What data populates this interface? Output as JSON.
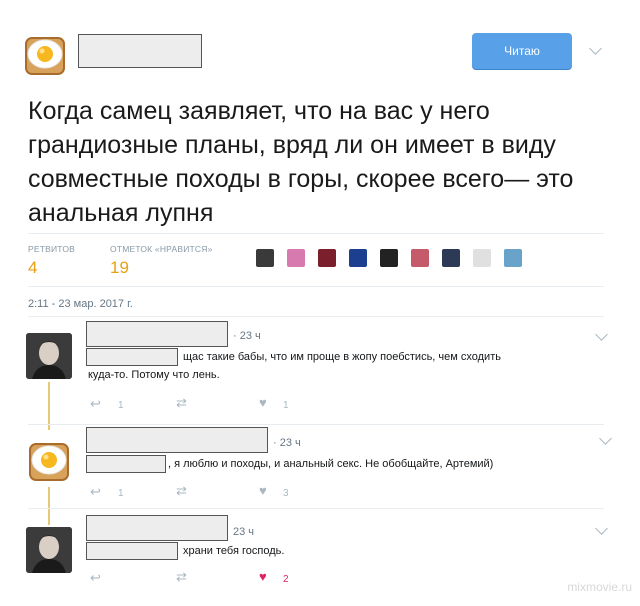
{
  "header": {
    "follow_label": "Читаю"
  },
  "tweet": {
    "text": "Когда самец заявляет, что на вас у него грандиозные планы, вряд ли он имеет в виду совместные походы в горы, скорее всего— это анальная лупня",
    "retweets_label": "РЕТВИТОВ",
    "retweets_count": "4",
    "likes_label": "ОТМЕТОК «НРАВИТСЯ»",
    "likes_count": "19",
    "timestamp": "2:11 - 23 мар. 2017 г."
  },
  "likers": [
    {
      "color": "#3a3a3a"
    },
    {
      "color": "#d77ab0"
    },
    {
      "color": "#7a1f2b"
    },
    {
      "color": "#1d3f8f"
    },
    {
      "color": "#222222"
    },
    {
      "color": "#c45a6a"
    },
    {
      "color": "#2c3a55"
    },
    {
      "color": "#e0e0e0"
    },
    {
      "color": "#6aa3c9"
    }
  ],
  "replies": [
    {
      "time": "· 23 ч",
      "text_line1": "щас такие бабы, что им проще в жопу поебстись, чем сходить",
      "text_line2": "куда-то. Потому что лень.",
      "reply_count": "1",
      "like_count": "1"
    },
    {
      "time": "· 23 ч",
      "text_line1": ", я люблю и походы, и анальный секс. Не обобщайте, Артемий)",
      "reply_count": "1",
      "like_count": "3"
    },
    {
      "time": "23 ч",
      "text_line1": "храни тебя господь.",
      "like_count": "2"
    }
  ],
  "watermark": "mixmovie.ru",
  "colors": {
    "accent": "#58a0e8",
    "stat": "#e6a012",
    "heart_active": "#e0245e",
    "thread": "#e8c978"
  }
}
